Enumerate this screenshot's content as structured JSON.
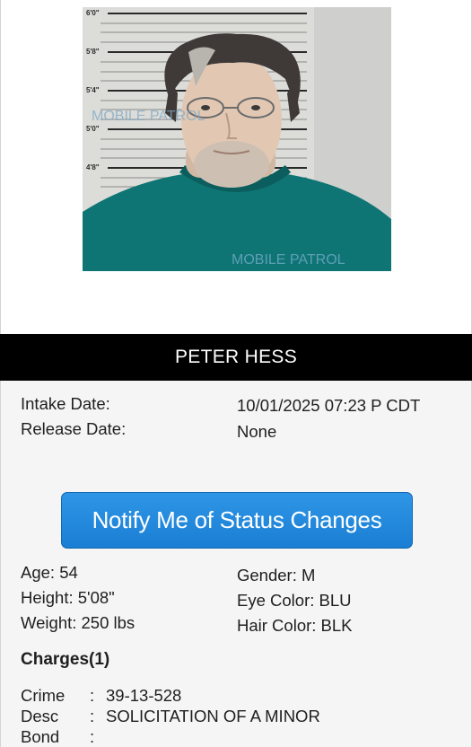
{
  "inmate": {
    "name": "PETER HESS",
    "intake_label": "Intake Date:",
    "intake_value": "10/01/2025 07:23 P CDT",
    "release_label": "Release Date:",
    "release_value": "None"
  },
  "notify_button": {
    "label": "Notify Me of Status Changes"
  },
  "profile": {
    "age": "Age: 54",
    "height": "Height: 5'08\"",
    "weight": "Weight: 250 lbs",
    "gender": "Gender: M",
    "eye_color": "Eye Color: BLU",
    "hair_color": "Hair Color: BLK"
  },
  "charges": {
    "title": "Charges(1)",
    "rows": [
      {
        "label": "Crime",
        "sep": ":",
        "value": "39-13-528"
      },
      {
        "label": "Desc",
        "sep": ":",
        "value": "SOLICITATION OF A MINOR"
      },
      {
        "label": "Bond",
        "sep": ":",
        "value": ""
      }
    ]
  },
  "photo": {
    "height_marks": [
      "6'0\"",
      "5'8\"",
      "5'4\"",
      "5'0\"",
      "4'8\""
    ],
    "watermark": "MOBILE PATROL"
  },
  "colors": {
    "button": "#1a7fd4",
    "name_bar": "#000000",
    "shirt": "#0f7574"
  }
}
